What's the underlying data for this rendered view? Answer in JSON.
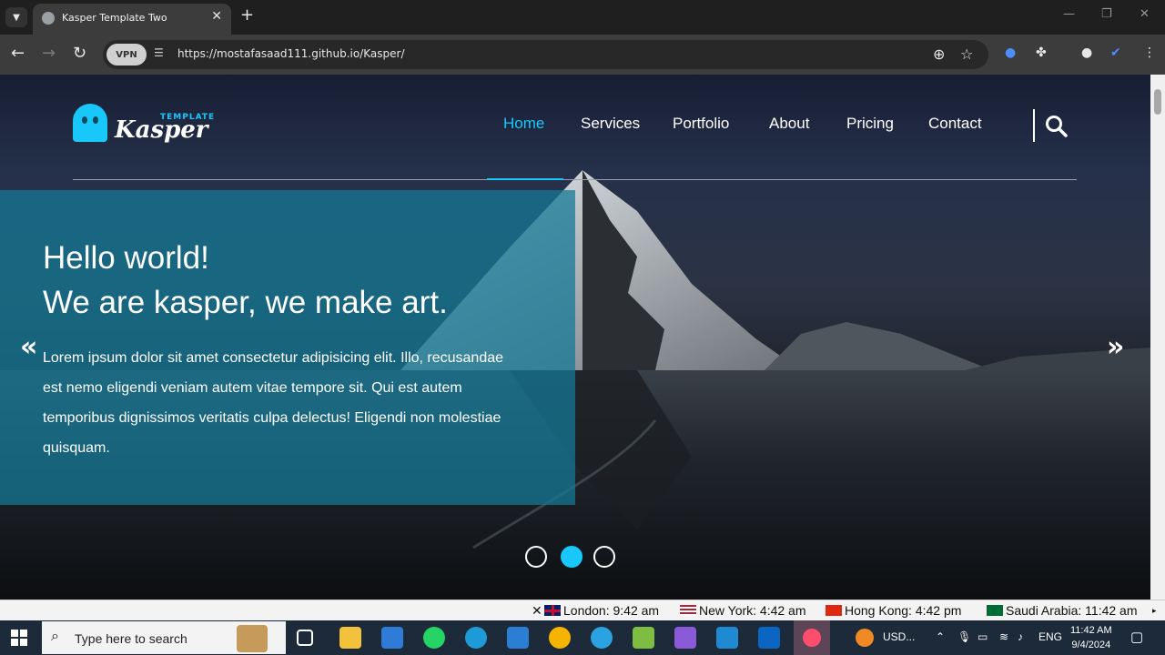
{
  "browser": {
    "tab_title": "Kasper Template Two",
    "new_tab_symbol": "+",
    "close_symbol": "✕",
    "vpn_badge": "VPN",
    "url": "https://mostafasaad111.github.io/Kasper/"
  },
  "site": {
    "logo_tag": "TEMPLATE",
    "logo_word": "Kasper",
    "nav": [
      "Home",
      "Services",
      "Portfolio",
      "About",
      "Pricing",
      "Contact"
    ],
    "active_nav": "Home",
    "hero": {
      "line1": "Hello world!",
      "line2": "We are kasper, we make art.",
      "paragraph": "Lorem ipsum dolor sit amet consectetur adipisicing elit. Illo, recusandae est nemo eligendi veniam autem vitae tempore sit. Qui est autem temporibus dignissimos veritatis culpa delectus! Eligendi non molestiae quisquam."
    },
    "prev_arrow": "«",
    "next_arrow": "»",
    "slides": 3,
    "active_slide": 2,
    "accent_color": "#19c8fa"
  },
  "ticker": {
    "items": [
      {
        "label": "London: 9:42 am"
      },
      {
        "label": "New York: 4:42 am"
      },
      {
        "label": "Hong Kong: 4:42 pm"
      },
      {
        "label": "Saudi Arabia: 11:42 am"
      }
    ]
  },
  "taskbar": {
    "search_placeholder": "Type here to search",
    "tray_stock": "USD...",
    "language": "ENG",
    "time": "11:42 AM",
    "date": "9/4/2024"
  }
}
